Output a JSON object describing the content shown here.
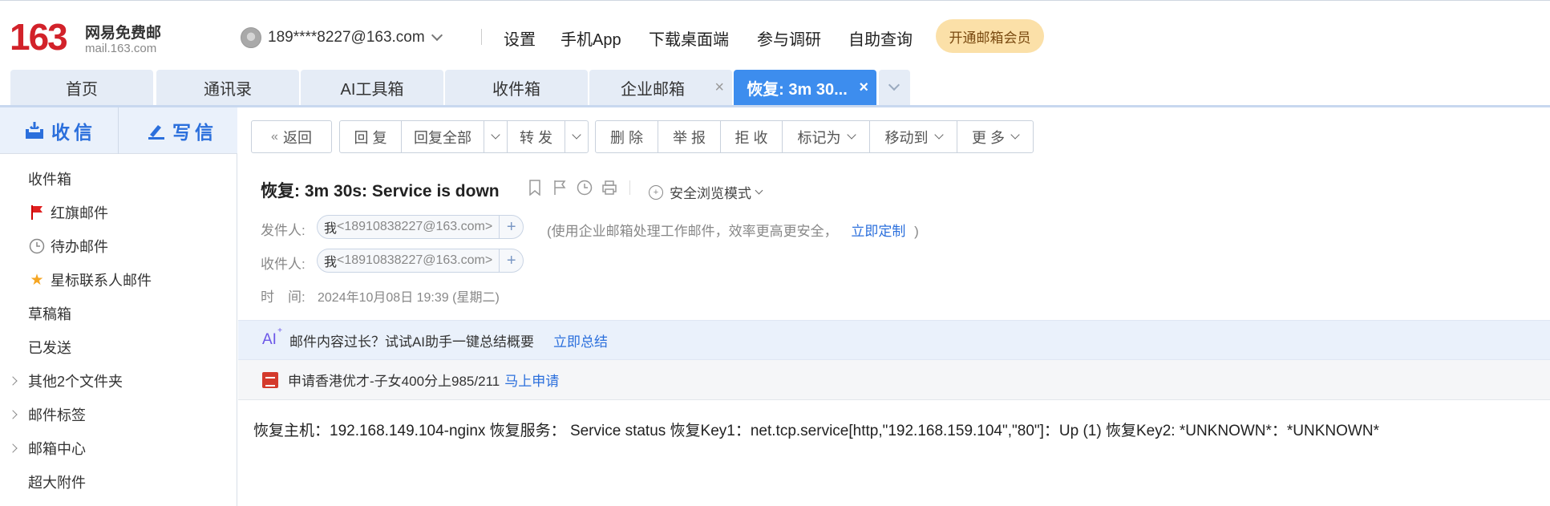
{
  "logo": {
    "number": "163",
    "cn_name": "网易免费邮",
    "domain": "mail.163.com"
  },
  "account": {
    "email": "189****8227@163.com"
  },
  "topnav": [
    "设置",
    "手机App",
    "下载桌面端",
    "参与调研",
    "自助查询"
  ],
  "vip_button": "开通邮箱会员",
  "tabs": [
    {
      "label": "首页"
    },
    {
      "label": "通讯录"
    },
    {
      "label": "AI工具箱"
    },
    {
      "label": "收件箱"
    },
    {
      "label": "企业邮箱",
      "close": "×"
    },
    {
      "label": "恢复: 3m 30...",
      "close": "×",
      "active": true
    }
  ],
  "sidebar": {
    "receive": "收信",
    "compose": "写信",
    "items": [
      {
        "label": "收件箱"
      },
      {
        "label": "红旗邮件",
        "icon": "red-flag-icon"
      },
      {
        "label": "待办邮件",
        "icon": "clock-icon"
      },
      {
        "label": "星标联系人邮件",
        "icon": "star-icon"
      },
      {
        "label": "草稿箱"
      },
      {
        "label": "已发送"
      },
      {
        "label": "其他2个文件夹",
        "expandable": true
      },
      {
        "label": "邮件标签",
        "expandable": true
      },
      {
        "label": "邮箱中心",
        "expandable": true
      },
      {
        "label": "超大附件"
      }
    ]
  },
  "toolbar": {
    "back": "返回",
    "reply": "回 复",
    "reply_all": "回复全部",
    "forward": "转 发",
    "delete": "删 除",
    "report": "举 报",
    "reject": "拒 收",
    "mark_as": "标记为",
    "move_to": "移动到",
    "more": "更 多"
  },
  "mail": {
    "subject": "恢复: 3m 30s: Service is down",
    "safe_mode": "安全浏览模式",
    "sender_label": "发件人:",
    "recipient_label": "收件人:",
    "time_label": "时　间:",
    "me": "我",
    "sender_address": "<18910838227@163.com>",
    "recipient_address": "<18910838227@163.com>",
    "note": "(使用企业邮箱处理工作邮件，效率更高更安全，",
    "note_link": "立即定制",
    "note_end": ")",
    "time": "2024年10月08日 19:39 (星期二)",
    "body": "恢复主机：192.168.149.104-nginx 恢复服务： Service status 恢复Key1：net.tcp.service[http,\"192.168.159.104\",\"80\"]：Up (1) 恢复Key2: *UNKNOWN*：*UNKNOWN*"
  },
  "ai_banner": {
    "logo": "AI",
    "text": "邮件内容过长？试试AI助手一键总结概要",
    "link": "立即总结"
  },
  "ad_banner": {
    "text": "申请香港优才-子女400分上985/211",
    "link": "马上申请"
  },
  "colors": {
    "accent": "#3d8dee",
    "link": "#2b6fdc",
    "brand_red": "#d2222a",
    "vip_bg": "#fbe0a8"
  }
}
